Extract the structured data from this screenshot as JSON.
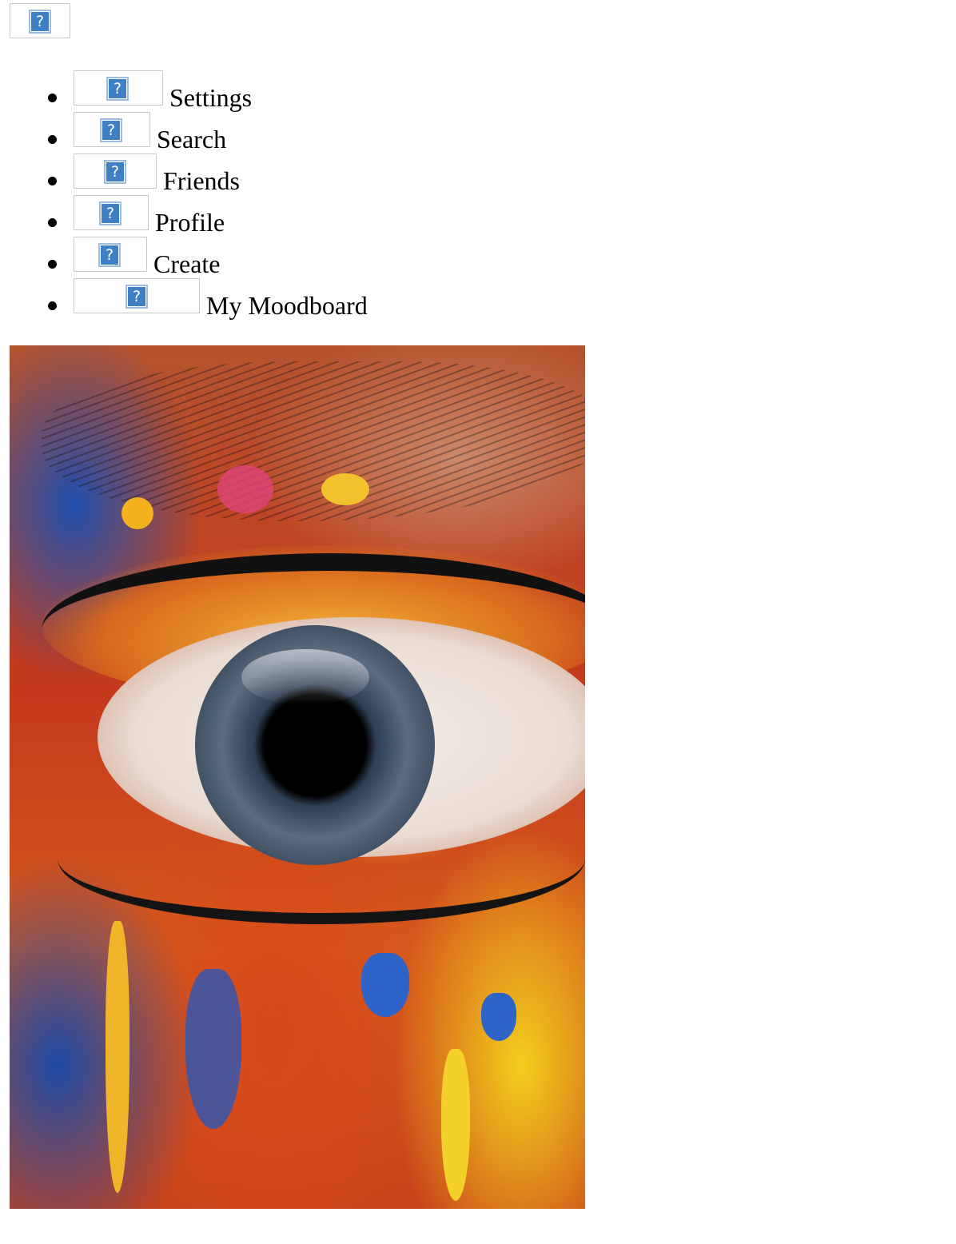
{
  "header": {
    "logo_icon": "broken-image-icon",
    "logo_glyph": "?"
  },
  "nav": {
    "items": [
      {
        "label": "Settings",
        "icon": "broken-image-icon",
        "glyph": "?"
      },
      {
        "label": "Search",
        "icon": "broken-image-icon",
        "glyph": "?"
      },
      {
        "label": "Friends",
        "icon": "broken-image-icon",
        "glyph": "?"
      },
      {
        "label": "Profile",
        "icon": "broken-image-icon",
        "glyph": "?"
      },
      {
        "label": "Create",
        "icon": "broken-image-icon",
        "glyph": "?"
      },
      {
        "label": "My Moodboard",
        "icon": "broken-image-icon",
        "glyph": "?"
      }
    ]
  },
  "main": {
    "hero_image": "colorful-painted-eye-photo"
  },
  "colors": {
    "broken_icon_fill": "#3f7fc4",
    "broken_icon_border": "#9ebbe0",
    "placeholder_border": "#c8c8c8",
    "text": "#000000",
    "background": "#ffffff"
  }
}
